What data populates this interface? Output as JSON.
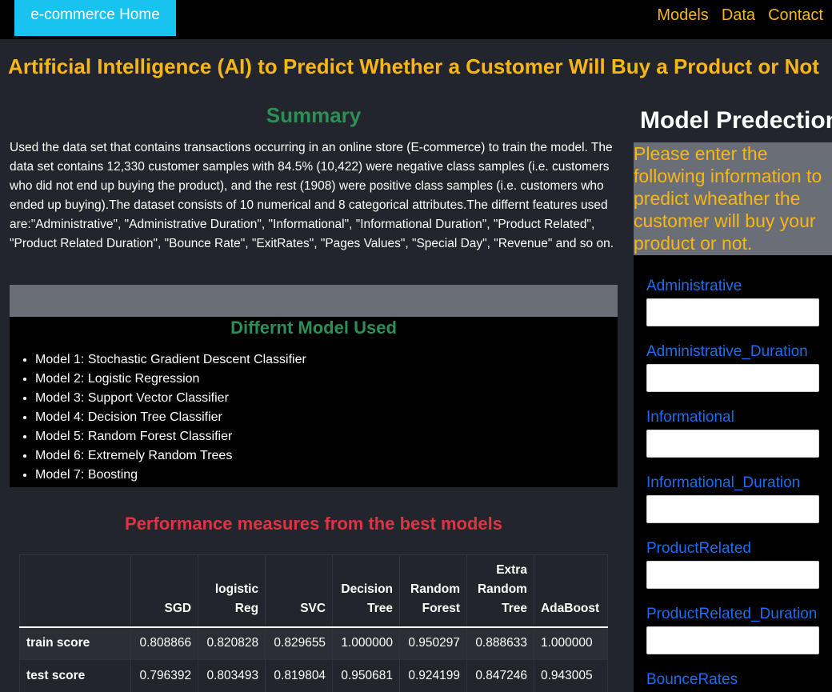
{
  "nav": {
    "brand": "e-commerce Home",
    "links": [
      "Models",
      "Data",
      "Contact"
    ]
  },
  "headline": "Artificial Intelligence (AI) to Predict Whether a Customer Will Buy a Product or Not",
  "summary": {
    "title": "Summary",
    "text": "Used the data set that contains transactions occurring in an online store (E-commerce) to train the model. The data set contains 12,330 customer samples with 84.5% (10,422) were negative class samples (i.e. customers who did not end up buying the product), and the rest (1908) were positive class samples (i.e. customers who ended up buying).The dataset consists of 10 numerical and 8 categorical attributes.The differnt features used are:\"Administrative\", \"Administrative Duration\", \"Informational\", \"Informational Duration\", \"Product Related\", \"Product Related Duration\", \"Bounce Rate\", \"ExitRates\", \"Pages Values\", \"Special Day\", \"Revenue\" and so on."
  },
  "models": {
    "title": "Differnt Model Used",
    "items": [
      "Model 1: Stochastic Gradient Descent Classifier",
      "Model 2: Logistic Regression",
      "Model 3: Support Vector Classifier",
      "Model 4: Decision Tree Classifier",
      "Model 5: Random Forest Classifier",
      "Model 6: Extremely Random Trees",
      "Model 7: Boosting"
    ]
  },
  "performance": {
    "title": "Performance measures from the best models",
    "columns": [
      "",
      "SGD",
      "logistic Reg",
      "SVC",
      "Decision Tree",
      "Random Forest",
      "Extra Random Tree",
      "AdaBoost"
    ],
    "rows": [
      {
        "label": "train score",
        "values": [
          "0.808866",
          "0.820828",
          "0.829655",
          "1.000000",
          "0.950297",
          "0.888633",
          "1.000000"
        ]
      },
      {
        "label": "test score",
        "values": [
          "0.796392",
          "0.803493",
          "0.819804",
          "0.950681",
          "0.924199",
          "0.847246",
          "0.943005"
        ]
      }
    ]
  },
  "prediction": {
    "title": "Model Predection",
    "instructions": "Please enter the following information to predict wheather the customer will buy your product or not.",
    "fields": [
      {
        "label": "Administrative",
        "value": ""
      },
      {
        "label": "Administrative_Duration",
        "value": ""
      },
      {
        "label": "Informational",
        "value": ""
      },
      {
        "label": "Informational_Duration",
        "value": ""
      },
      {
        "label": "ProductRelated",
        "value": ""
      },
      {
        "label": "ProductRelated_Duration",
        "value": ""
      },
      {
        "label": "BounceRates",
        "value": ""
      }
    ]
  }
}
